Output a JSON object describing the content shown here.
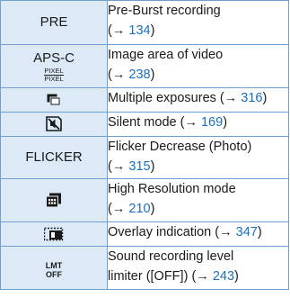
{
  "rows": [
    {
      "icon": {
        "type": "text",
        "text": "PRE",
        "name": "pre-burst-icon"
      },
      "desc_lines": [
        "Pre-Burst recording",
        ""
      ],
      "page": "134"
    },
    {
      "icon": {
        "type": "aps",
        "main": "APS-C",
        "sub_top": "PIXEL",
        "sub_bottom": "PIXEL",
        "name": "image-area-icon"
      },
      "desc_lines": [
        "Image area of video",
        ""
      ],
      "page": "238"
    },
    {
      "icon": {
        "type": "multi-exposure",
        "name": "multiple-exposures-icon"
      },
      "desc_lines": [
        "Multiple exposures "
      ],
      "page": "316"
    },
    {
      "icon": {
        "type": "silent",
        "name": "silent-mode-icon"
      },
      "desc_lines": [
        "Silent mode "
      ],
      "page": "169"
    },
    {
      "icon": {
        "type": "text",
        "text": "FLICKER",
        "name": "flicker-decrease-icon"
      },
      "desc_lines": [
        "Flicker Decrease (Photo)",
        ""
      ],
      "page": "315"
    },
    {
      "icon": {
        "type": "high-res",
        "name": "high-resolution-icon"
      },
      "desc_lines": [
        "High Resolution mode",
        ""
      ],
      "page": "210"
    },
    {
      "icon": {
        "type": "overlay",
        "name": "overlay-indication-icon"
      },
      "desc_lines": [
        "Overlay indication "
      ],
      "page": "347"
    },
    {
      "icon": {
        "type": "lmt",
        "top": "LMT",
        "bottom": "OFF",
        "name": "sound-level-limiter-icon"
      },
      "desc_lines": [
        "Sound recording level",
        "limiter ([OFF]) "
      ],
      "page": "243"
    }
  ],
  "arrow": "→",
  "colors": {
    "icon_bg": "#dce9f6",
    "border": "#6f9fcc",
    "link": "#1a6fbd"
  }
}
